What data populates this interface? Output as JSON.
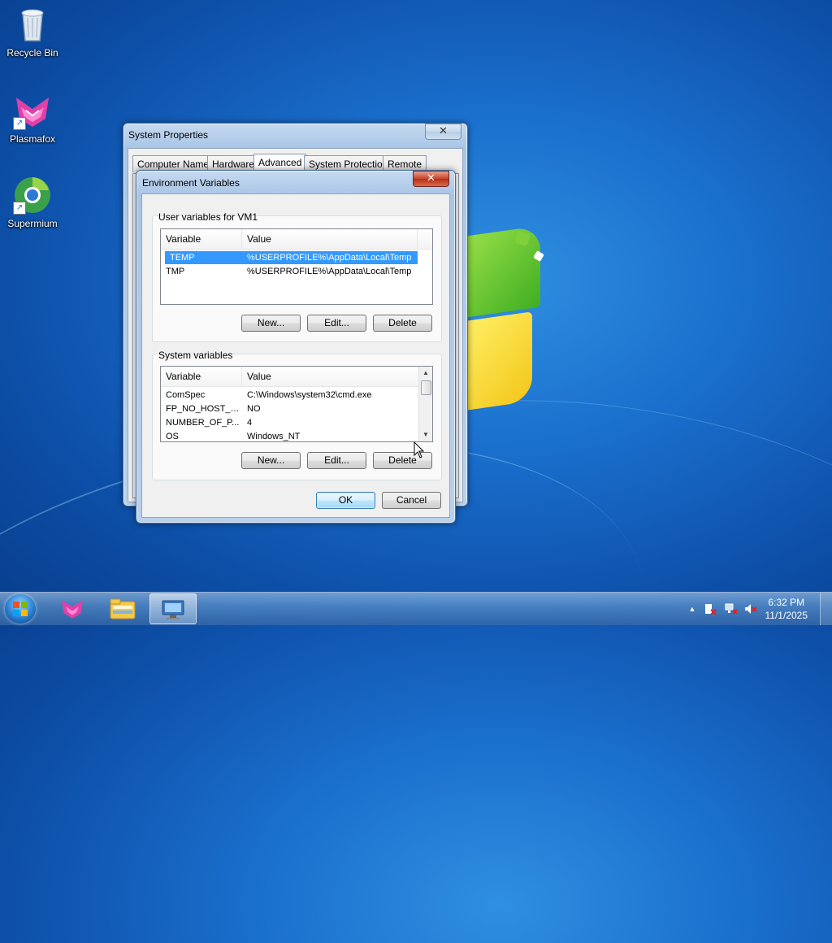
{
  "desktop": {
    "icons": [
      {
        "label": "Recycle Bin",
        "icon": "recycle-bin-icon"
      },
      {
        "label": "Plasmafox",
        "icon": "plasmafox-icon"
      },
      {
        "label": "Supermium",
        "icon": "supermium-icon"
      }
    ]
  },
  "system_properties": {
    "title": "System Properties",
    "close": "✕",
    "tabs": [
      "Computer Name",
      "Hardware",
      "Advanced",
      "System Protection",
      "Remote"
    ],
    "active_tab": "Advanced"
  },
  "env_dialog": {
    "title": "Environment Variables",
    "close": "✕",
    "user_group_label": "User variables for VM1",
    "user_columns": [
      "Variable",
      "Value"
    ],
    "user_rows": [
      {
        "name": "TEMP",
        "value": "%USERPROFILE%\\AppData\\Local\\Temp",
        "selected": true
      },
      {
        "name": "TMP",
        "value": "%USERPROFILE%\\AppData\\Local\\Temp",
        "selected": false
      }
    ],
    "user_buttons": {
      "new": "New...",
      "edit": "Edit...",
      "delete": "Delete"
    },
    "system_group_label": "System variables",
    "system_columns": [
      "Variable",
      "Value"
    ],
    "system_rows": [
      {
        "name": "ComSpec",
        "value": "C:\\Windows\\system32\\cmd.exe"
      },
      {
        "name": "FP_NO_HOST_C...",
        "value": "NO"
      },
      {
        "name": "NUMBER_OF_P...",
        "value": "4"
      },
      {
        "name": "OS",
        "value": "Windows_NT"
      }
    ],
    "system_buttons": {
      "new": "New...",
      "edit": "Edit...",
      "delete": "Delete"
    },
    "ok": "OK",
    "cancel": "Cancel"
  },
  "taskbar": {
    "start_icon": "windows-start-icon",
    "pinned": [
      {
        "icon": "plasmafox-icon",
        "active": false
      },
      {
        "icon": "file-explorer-icon",
        "active": false
      },
      {
        "icon": "system-properties-icon",
        "active": true
      }
    ],
    "tray": {
      "show_hidden": "▲",
      "time": "6:32 PM",
      "date": "11/1/2025"
    }
  }
}
